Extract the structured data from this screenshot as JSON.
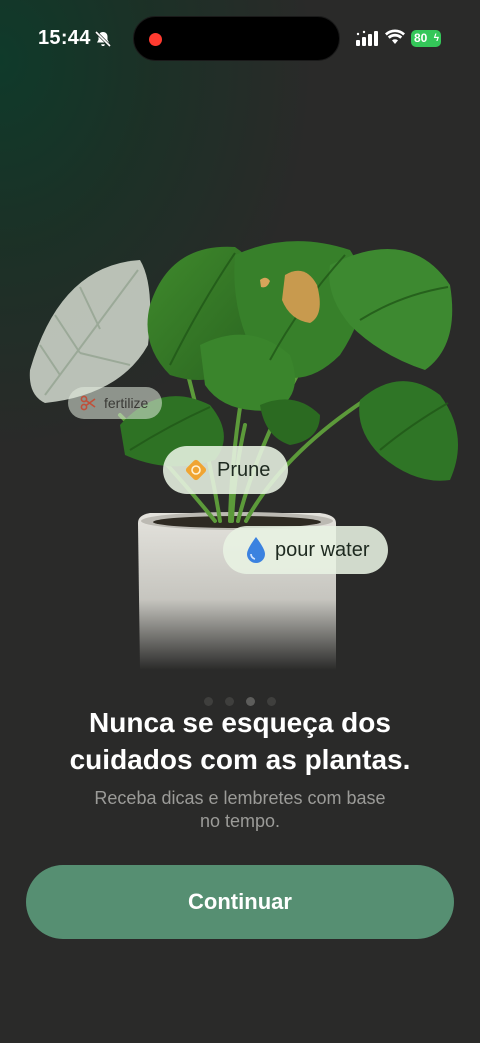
{
  "status_bar": {
    "time": "15:44",
    "battery_level": "80",
    "icons": [
      "bell-slash-icon",
      "signal-icon",
      "wifi-icon",
      "battery-icon"
    ],
    "battery_color": "#34c759",
    "recording_dot_color": "#ff3b30"
  },
  "illustration": {
    "subject": "monstera-plant-icon",
    "chips": [
      {
        "label": "fertilize",
        "icon": "scissors-icon"
      },
      {
        "label": "Prune",
        "icon": "prune-icon"
      },
      {
        "label": "pour water",
        "icon": "water-drop-icon"
      }
    ]
  },
  "pager": {
    "count": 4,
    "active_index": 2
  },
  "headline": [
    "Nunca se esqueça dos",
    "cuidados com as plantas."
  ],
  "subtitle": [
    "Receba dicas e lembretes com base",
    "no tempo."
  ],
  "cta": {
    "label": "Continuar",
    "color": "#568f72"
  },
  "colors": {
    "background": "#2a2a29",
    "accent_green": "#568f72"
  }
}
